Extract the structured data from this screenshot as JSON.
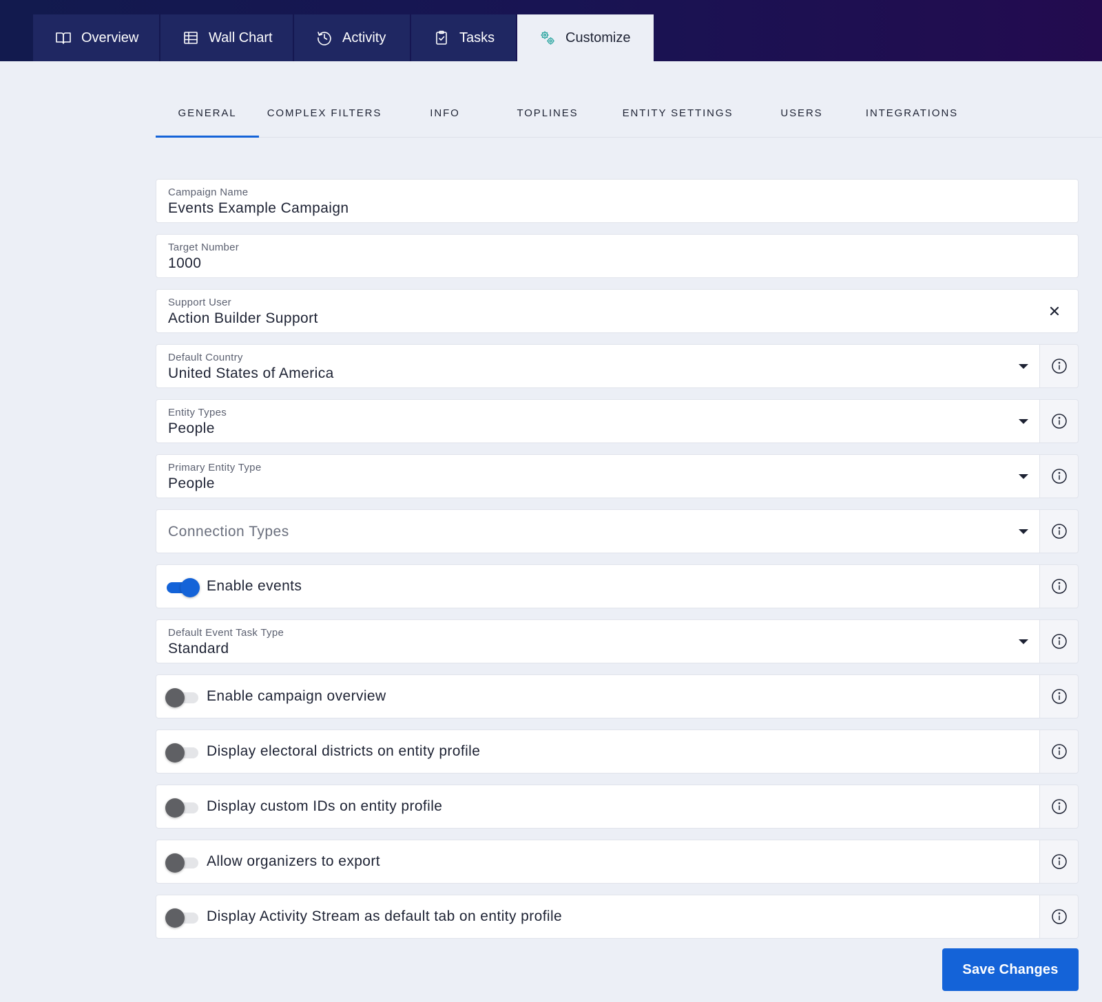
{
  "nav": {
    "tabs": [
      {
        "label": "Overview",
        "icon": "book-icon"
      },
      {
        "label": "Wall Chart",
        "icon": "table-icon"
      },
      {
        "label": "Activity",
        "icon": "history-icon"
      },
      {
        "label": "Tasks",
        "icon": "clipboard-icon"
      },
      {
        "label": "Customize",
        "icon": "gears-icon",
        "active": true
      }
    ]
  },
  "subnav": {
    "tabs": [
      {
        "label": "GENERAL",
        "active": true
      },
      {
        "label": "COMPLEX FILTERS"
      },
      {
        "label": "INFO"
      },
      {
        "label": "TOPLINES"
      },
      {
        "label": "ENTITY SETTINGS"
      },
      {
        "label": "USERS"
      },
      {
        "label": "INTEGRATIONS"
      }
    ]
  },
  "form": {
    "campaign_name": {
      "label": "Campaign Name",
      "value": "Events Example Campaign"
    },
    "target_number": {
      "label": "Target Number",
      "value": "1000"
    },
    "support_user": {
      "label": "Support User",
      "value": "Action Builder Support"
    },
    "default_country": {
      "label": "Default Country",
      "value": "United States of America"
    },
    "entity_types": {
      "label": "Entity Types",
      "value": "People"
    },
    "primary_entity_type": {
      "label": "Primary Entity Type",
      "value": "People"
    },
    "connection_types": {
      "placeholder": "Connection Types"
    },
    "enable_events": {
      "label": "Enable events",
      "enabled": true
    },
    "default_event_task_type": {
      "label": "Default Event Task Type",
      "value": "Standard"
    },
    "enable_campaign_overview": {
      "label": "Enable campaign overview",
      "enabled": false
    },
    "display_electoral_districts": {
      "label": "Display electoral districts on entity profile",
      "enabled": false
    },
    "display_custom_ids": {
      "label": "Display custom IDs on entity profile",
      "enabled": false
    },
    "allow_export": {
      "label": "Allow organizers to export",
      "enabled": false
    },
    "activity_stream_default": {
      "label": "Display Activity Stream as default tab on entity profile",
      "enabled": false
    }
  },
  "actions": {
    "save_label": "Save Changes"
  },
  "colors": {
    "header_gradient_start": "#121a4e",
    "header_gradient_end": "#230b4f",
    "tab_bg": "#1f2762",
    "accent": "#1463d8",
    "page_bg": "#eceff6",
    "toggle_off_knob": "#5f6064"
  }
}
